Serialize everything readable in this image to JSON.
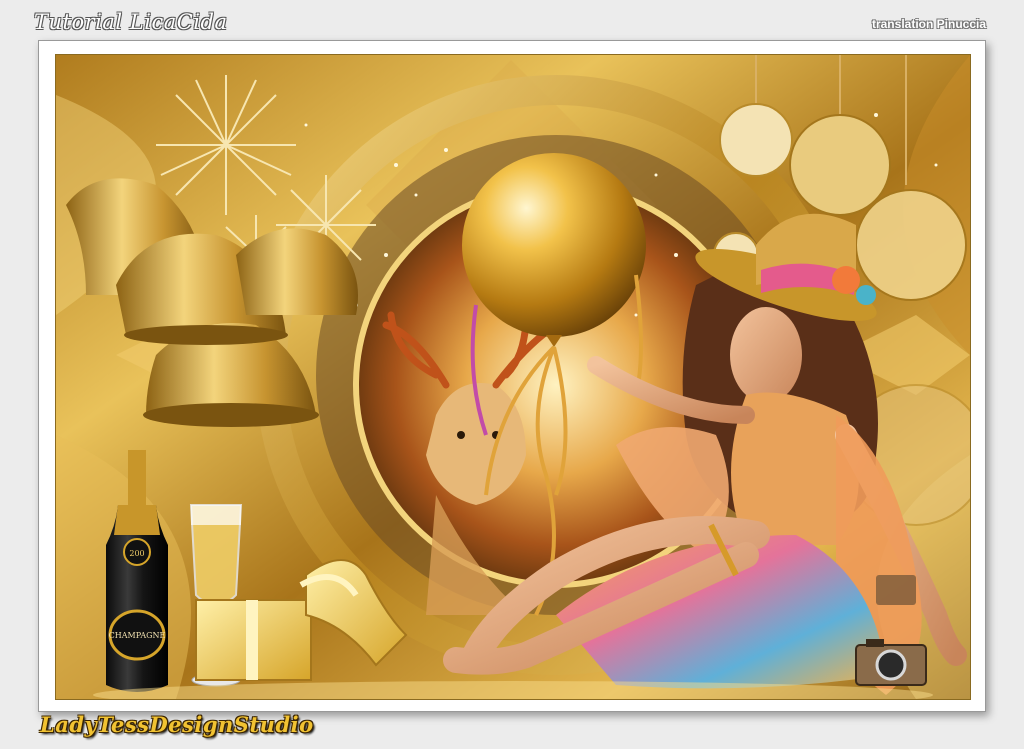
{
  "header": {
    "tutorial_credit": "Tutorial LicaCida",
    "translation_credit": "translation Pinuccia"
  },
  "artwork": {
    "bottle_label": "CHAMPAGNE",
    "bottle_year": "200"
  },
  "footer": {
    "signature": "LadyTessDesignStudio"
  },
  "colors": {
    "page_background": "#ececec",
    "gold_dark": "#7a5410",
    "gold_mid": "#c8962a",
    "gold_light": "#f4d77a"
  }
}
